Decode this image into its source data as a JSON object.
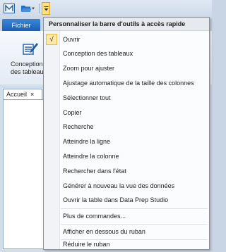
{
  "ribbon": {
    "file_tab": "Fichier",
    "design_label_line1": "Conception",
    "design_label_line2": "des tableaux"
  },
  "document": {
    "tab_label": "Accueil",
    "tab_close": "×"
  },
  "menu": {
    "header": "Personnaliser la barre d'outils à accès rapide",
    "checked_mark": "√",
    "items": [
      "Ouvrir",
      "Conception des tableaux",
      "Zoom pour ajuster",
      "Ajustage automatique de la taille des colonnes",
      "Sélectionner tout",
      "Copier",
      "Recherche",
      "Atteindre la ligne",
      "Atteindre la colonne",
      "Rechercher dans l'état",
      "Générer à nouveau la vue des données",
      "Ouvrir la table dans Data Prep Studio",
      "Plus de commandes...",
      "Afficher en dessous du ruban",
      "Réduire le ruban"
    ]
  },
  "colors": {
    "accent": "#1b5fb4",
    "highlight": "#ffe07a"
  }
}
